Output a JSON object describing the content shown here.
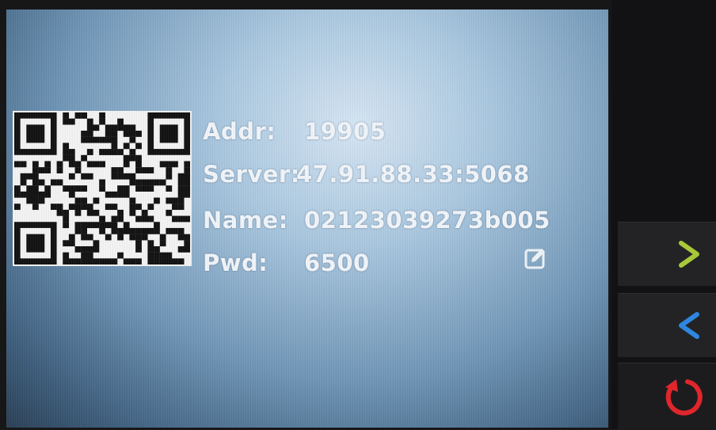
{
  "info": {
    "addr": {
      "label": "Addr:",
      "value": "19905"
    },
    "server": {
      "label": "Server:",
      "value": "47.91.88.33:5068"
    },
    "name": {
      "label": "Name:",
      "value": "02123039273b005"
    },
    "pwd": {
      "label": "Pwd:",
      "value": "6500"
    }
  },
  "icons": {
    "edit": "edit-icon",
    "next": "chevron-right-icon",
    "prev": "chevron-left-icon",
    "reset": "reset-icon"
  },
  "colors": {
    "next": "#a8c83a",
    "prev": "#2f86e0",
    "reset": "#e0262c"
  }
}
